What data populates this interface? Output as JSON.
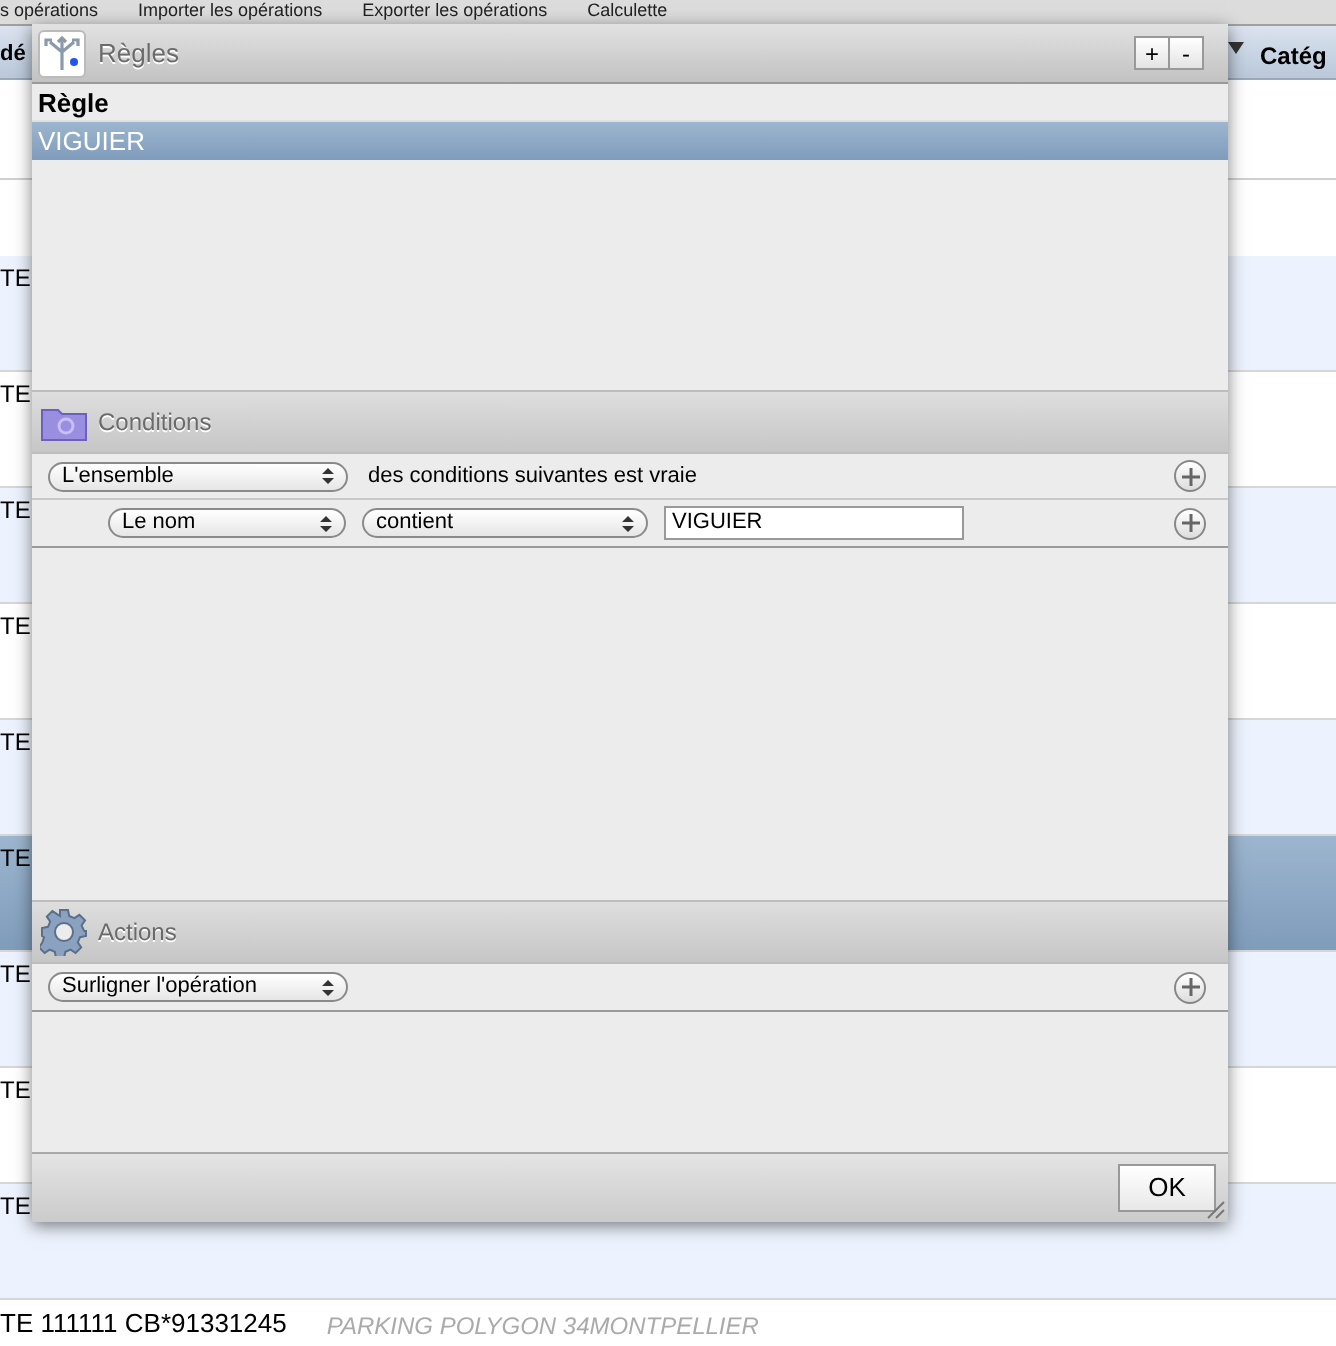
{
  "background_window": {
    "toolbar": [
      "s opérations",
      "Importer les opérations",
      "Exporter les opérations",
      "Calculette"
    ],
    "columns": [
      "dé",
      "Catég"
    ],
    "rows": [
      {
        "text": "TE",
        "selected": false
      },
      {
        "text": "TE",
        "selected": false
      },
      {
        "text": "TE",
        "selected": false
      },
      {
        "text": "TE",
        "selected": false
      },
      {
        "text": "TE",
        "selected": false
      },
      {
        "text": "TE",
        "selected": true
      },
      {
        "text": "TE",
        "selected": false
      },
      {
        "text": "TE",
        "selected": false
      },
      {
        "text": "TE",
        "selected": false
      },
      {
        "text": "TE 111111 CB*91331245",
        "detail": "PARKING POLYGON 34MONTPELLIER",
        "selected": false
      }
    ]
  },
  "dialog": {
    "title": "Règles",
    "buttons": [
      "+",
      "-"
    ],
    "rules": {
      "column": "Règle",
      "rows": [
        {
          "name": "VIGUIER",
          "selected": true
        }
      ]
    },
    "conditions": {
      "title": "Conditions",
      "match": {
        "value": "L'ensemble",
        "text": "des conditions suivantes est vraie"
      },
      "rows": [
        {
          "field": "Le nom",
          "operator": "contient",
          "value": "VIGUIER"
        }
      ]
    },
    "actions": {
      "title": "Actions",
      "rows": [
        {
          "action": "Surligner l'opération"
        }
      ]
    },
    "ok": "OK"
  }
}
